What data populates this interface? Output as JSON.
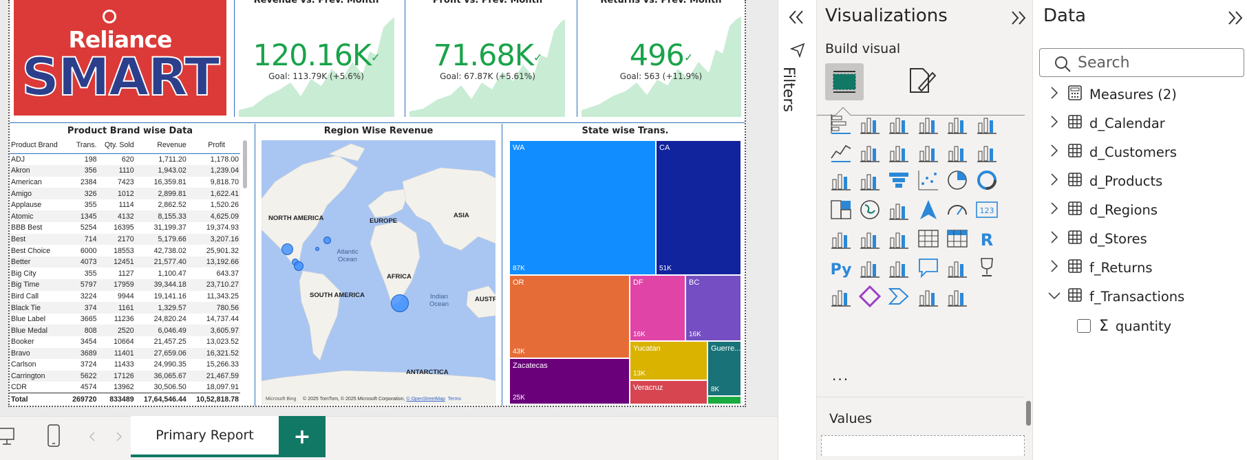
{
  "brand": {
    "line1": "Reliance",
    "line2": "SMART"
  },
  "kpis": [
    {
      "title": "Revenue vs. Prev. Month",
      "value": "120.16K",
      "goal": "Goal: 113.79K (+5.6%)"
    },
    {
      "title": "Profit vs. Prev. Month",
      "value": "71.68K",
      "goal": "Goal: 67.87K (+5.61%)"
    },
    {
      "title": "Returns vs. Prev. Month",
      "value": "496",
      "goal": "Goal: 563 (+11.9%)"
    }
  ],
  "brand_table": {
    "title": "Product Brand wise Data",
    "columns": [
      "Product Brand",
      "Trans.",
      "Qty. Sold",
      "Revenue",
      "Profit"
    ],
    "rows": [
      [
        "ADJ",
        "198",
        "620",
        "1,711.20",
        "1,178.00"
      ],
      [
        "Akron",
        "356",
        "1110",
        "1,943.02",
        "1,239.04"
      ],
      [
        "American",
        "2384",
        "7423",
        "16,359.81",
        "9,818.70"
      ],
      [
        "Amigo",
        "326",
        "1012",
        "2,899.81",
        "1,622.41"
      ],
      [
        "Applause",
        "355",
        "1114",
        "2,862.52",
        "1,520.26"
      ],
      [
        "Atomic",
        "1345",
        "4132",
        "8,155.33",
        "4,625.09"
      ],
      [
        "BBB Best",
        "5254",
        "16395",
        "31,199.37",
        "19,374.93"
      ],
      [
        "Best",
        "714",
        "2170",
        "5,179.66",
        "3,207.16"
      ],
      [
        "Best Choice",
        "6000",
        "18553",
        "42,738.02",
        "25,901.32"
      ],
      [
        "Better",
        "4073",
        "12451",
        "21,577.40",
        "13,192.66"
      ],
      [
        "Big City",
        "355",
        "1127",
        "1,100.47",
        "643.37"
      ],
      [
        "Big Time",
        "5797",
        "17959",
        "39,344.18",
        "23,710.27"
      ],
      [
        "Bird Call",
        "3224",
        "9944",
        "19,141.16",
        "11,343.25"
      ],
      [
        "Black Tie",
        "374",
        "1161",
        "1,329.57",
        "780.56"
      ],
      [
        "Blue Label",
        "3665",
        "11236",
        "24,820.24",
        "14,737.44"
      ],
      [
        "Blue Medal",
        "808",
        "2520",
        "6,046.49",
        "3,605.97"
      ],
      [
        "Booker",
        "3454",
        "10664",
        "21,457.25",
        "13,023.52"
      ],
      [
        "Bravo",
        "3689",
        "11401",
        "27,659.06",
        "16,321.52"
      ],
      [
        "Carlson",
        "3724",
        "11433",
        "24,990.35",
        "15,266.33"
      ],
      [
        "Carrington",
        "5622",
        "17126",
        "36,065.67",
        "21,467.59"
      ],
      [
        "CDR",
        "4574",
        "13962",
        "30,506.50",
        "18,097.91"
      ]
    ],
    "total": [
      "Total",
      "269720",
      "833489",
      "17,64,546.44",
      "10,52,818.78"
    ]
  },
  "map": {
    "title": "Region Wise Revenue",
    "labels": [
      "NORTH AMERICA",
      "EUROPE",
      "ASIA",
      "AFRICA",
      "SOUTH AMERICA",
      "AUSTR",
      "ANTARCTICA"
    ],
    "oceans": [
      "Atlantic Ocean",
      "Indian Ocean"
    ],
    "bing": "Microsoft Bing",
    "copyright": "© 2025 TomTom, © 2025 Microsoft Corporation,",
    "osm": "© OpenStreetMap",
    "terms": "Terms"
  },
  "treemap": {
    "title": "State wise Trans.",
    "tiles": [
      {
        "label": "WA",
        "value": "87K",
        "color": "#118dff"
      },
      {
        "label": "CA",
        "value": "51K",
        "color": "#12239e"
      },
      {
        "label": "OR",
        "value": "43K",
        "color": "#e66c37"
      },
      {
        "label": "DF",
        "value": "16K",
        "color": "#e044a7"
      },
      {
        "label": "BC",
        "value": "16K",
        "color": "#744ec2"
      },
      {
        "label": "Zacatecas",
        "value": "25K",
        "color": "#6b007b"
      },
      {
        "label": "Yucatan",
        "value": "13K",
        "color": "#d9b300"
      },
      {
        "label": "Guerre...",
        "value": "8K",
        "color": "#197278"
      },
      {
        "label": "Veracruz",
        "value": "",
        "color": "#d64550"
      },
      {
        "label": "",
        "value": "",
        "color": "#1aab40"
      }
    ]
  },
  "bottom": {
    "tab": "Primary Report",
    "add": "+"
  },
  "filters": {
    "label": "Filters"
  },
  "viz": {
    "title": "Visualizations",
    "sub": "Build visual",
    "values": "Values",
    "more": "...",
    "r": "R",
    "py": "Py",
    "card": "123"
  },
  "data_pane": {
    "title": "Data",
    "search_placeholder": "Search",
    "fields": [
      {
        "name": "Measures (2)",
        "icon": "calculator-icon",
        "expanded": false
      },
      {
        "name": "d_Calendar",
        "icon": "table-icon",
        "expanded": false
      },
      {
        "name": "d_Customers",
        "icon": "table-icon",
        "expanded": false
      },
      {
        "name": "d_Products",
        "icon": "table-icon",
        "expanded": false
      },
      {
        "name": "d_Regions",
        "icon": "table-icon",
        "expanded": false
      },
      {
        "name": "d_Stores",
        "icon": "table-icon",
        "expanded": false
      },
      {
        "name": "f_Returns",
        "icon": "table-icon",
        "expanded": false
      },
      {
        "name": "f_Transactions",
        "icon": "table-icon",
        "expanded": true
      }
    ],
    "subfield": "quantity"
  }
}
